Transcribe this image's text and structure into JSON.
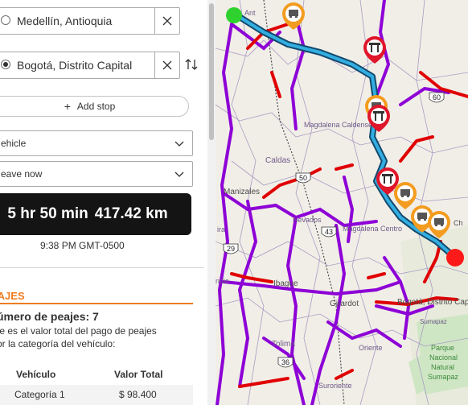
{
  "route": {
    "origin": {
      "value": "Medellín, Antioquia"
    },
    "destination": {
      "value": "Bogotá, Distrito Capital"
    },
    "add_stop_label": "Add stop",
    "mode_select": "ehicle",
    "time_select": "eave now"
  },
  "summary": {
    "duration": "5 hr 50 min",
    "distance": "417.42 km",
    "arrival": "9:38 PM GMT-0500"
  },
  "tolls": {
    "heading": "EAJES",
    "count": "úmero de peajes: 7",
    "desc_line1": "te es el valor total del pago de peajes",
    "desc_line2": "or la categoría del vehículo:",
    "col_vehicle": "Vehículo",
    "col_total": "Valor Total",
    "rows": [
      {
        "vehicle": "Categoría 1",
        "total": "$ 98.400"
      }
    ]
  },
  "map": {
    "labels": {
      "ant": "Ant",
      "magdalena_caldense": "Magdalena Caldense",
      "caldas": "Caldas",
      "manizales": "Manizales",
      "nevados": "Nevados",
      "magdalena_centro": "Magdalena Centro",
      "ibague": "Ibague",
      "girardot": "Girardot",
      "bogota": "Bogotá, Distrito Capita",
      "sumapaz": "Sumapaz",
      "tolima": "Tolima",
      "oriente": "Oriente",
      "suroriente": "Suroriente",
      "parque": "Parque",
      "nacional": "Nacional",
      "natural": "Natural",
      "sumapaz_park": "Sumapaz",
      "indio": "ndio",
      "mira": "ira",
      "ch": "Ch"
    },
    "shields": {
      "r60": "60",
      "r50": "50",
      "r43": "43",
      "r29": "29",
      "r36": "36"
    },
    "colors": {
      "route": "#1f7fb8",
      "roads_major": "#e00000",
      "roads_secondary": "#8d00d6",
      "toll_orange": "#f39c1f",
      "toll_red": "#e0162b",
      "start": "#2fd12f",
      "end": "#ff1a1a"
    }
  },
  "icons": {
    "clear": "close-icon",
    "swap": "swap-icon",
    "chevron": "chevron-down-icon",
    "toll": "toll-icon",
    "toll_truck": "toll-truck-icon"
  }
}
